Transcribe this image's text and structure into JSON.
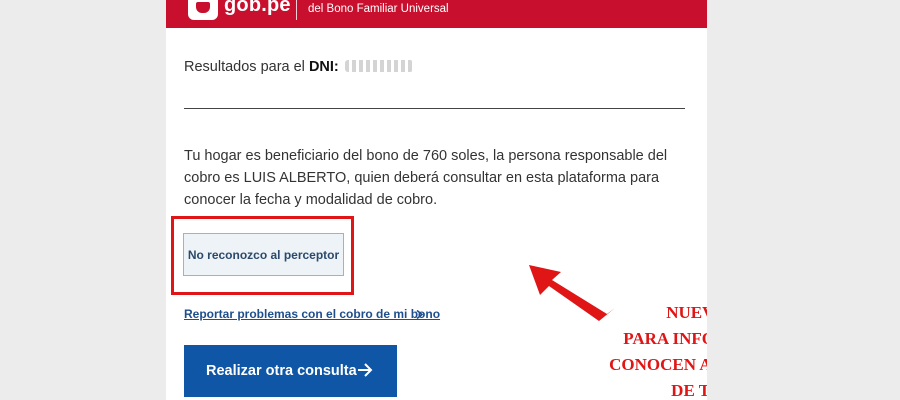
{
  "header": {
    "brand": "gob.pe",
    "subtitle": "del Bono Familiar Universal",
    "colors": {
      "background": "#c8102e",
      "text": "#ffffff"
    }
  },
  "results": {
    "prefix": "Resultados para el ",
    "dni_label": "DNI:"
  },
  "message": "Tu hogar es beneficiario del bono de 760 soles, la persona responsable del cobro es LUIS ALBERTO, quien deberá consultar en esta plataforma para conocer la fecha y modalidad de cobro.",
  "actions": {
    "not_recognize_label": "No reconozco al perceptor",
    "report_link": "Reportar problemas con el cobro de mi bono",
    "primary_label": "Realizar otra consulta",
    "primary_color": "#0f57a6"
  },
  "annotation": {
    "lines": [
      "NUEVA OPCIÓN",
      "PARA INFORMAR QUE NO",
      "CONOCEN AL BENEFICIARIO",
      "DE TU HOGAR"
    ],
    "color": "#e01515"
  },
  "icons": {
    "logo": "peru-shield-logo",
    "link_chevron": "chevron-right-icon",
    "button_arrow": "arrow-right-icon",
    "callout": "red-arrow-icon"
  }
}
